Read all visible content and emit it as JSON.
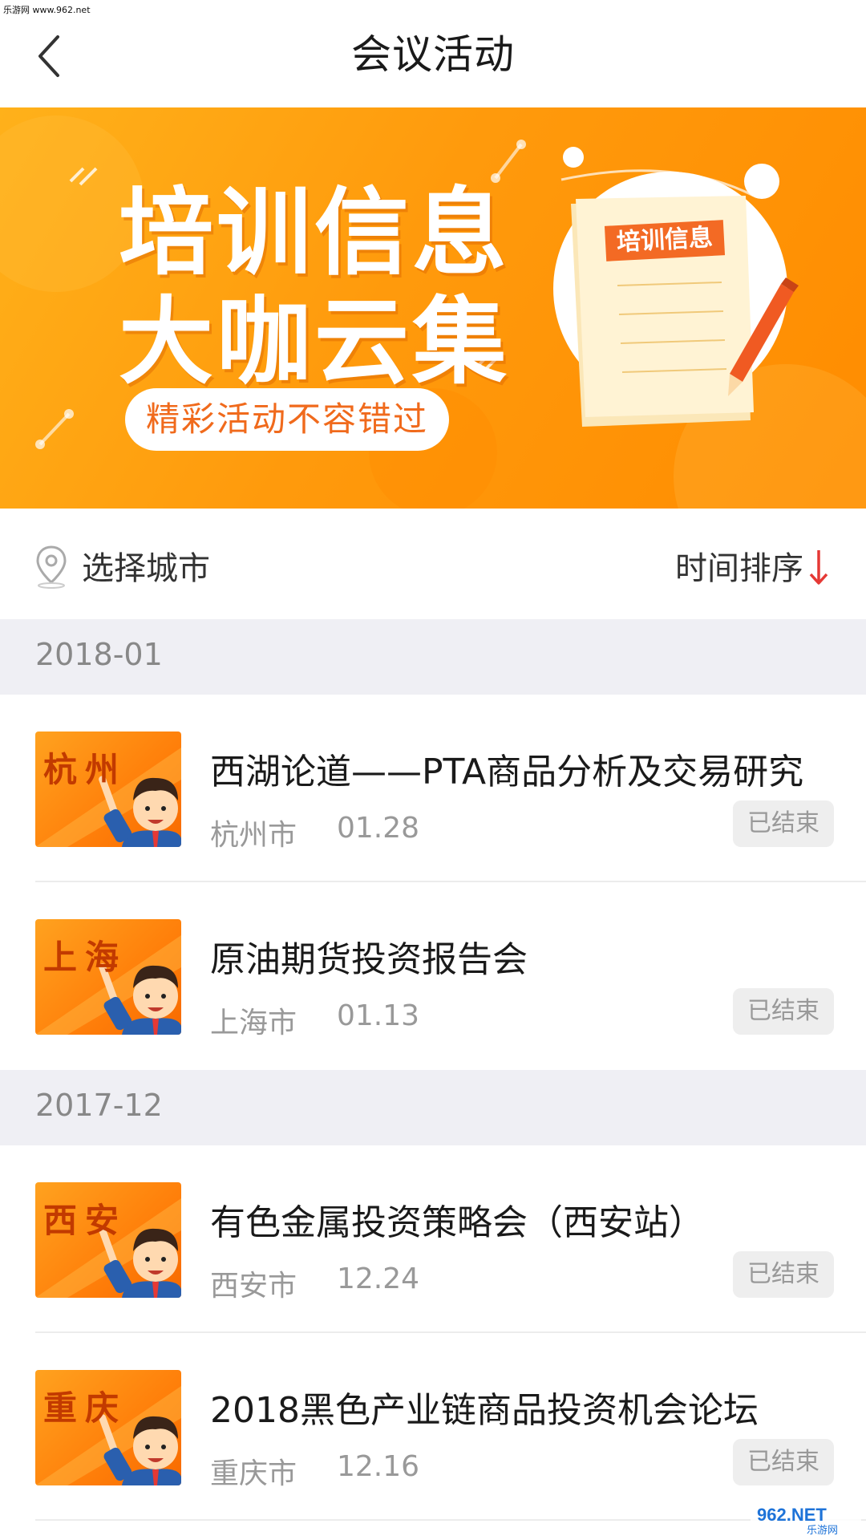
{
  "watermark_top": "乐游网 www.962.net",
  "header": {
    "title": "会议活动",
    "back_icon": "chevron-left-icon"
  },
  "banner": {
    "line1": "培训信息",
    "line2": "大咖云集",
    "pill": "精彩活动不容错过",
    "paper_label": "培训信息"
  },
  "filter": {
    "city_label": "选择城市",
    "sort_label": "时间排序",
    "sort_direction": "desc",
    "accent_color": "#e53935"
  },
  "sections": [
    {
      "month": "2018-01",
      "items": [
        {
          "thumb_city": "杭州",
          "title": "西湖论道——PTA商品分析及交易研究",
          "city": "杭州市",
          "date": "01.28",
          "status": "已结束"
        },
        {
          "thumb_city": "上海",
          "title": "原油期货投资报告会",
          "city": "上海市",
          "date": "01.13",
          "status": "已结束"
        }
      ]
    },
    {
      "month": "2017-12",
      "items": [
        {
          "thumb_city": "西安",
          "title": "有色金属投资策略会（西安站）",
          "city": "西安市",
          "date": "12.24",
          "status": "已结束"
        },
        {
          "thumb_city": "重庆",
          "title": "2018黑色产业链商品投资机会论坛",
          "city": "重庆市",
          "date": "12.16",
          "status": "已结束"
        }
      ]
    }
  ],
  "watermark_bottom": {
    "brand": "962.NET",
    "sub": "乐游网"
  }
}
